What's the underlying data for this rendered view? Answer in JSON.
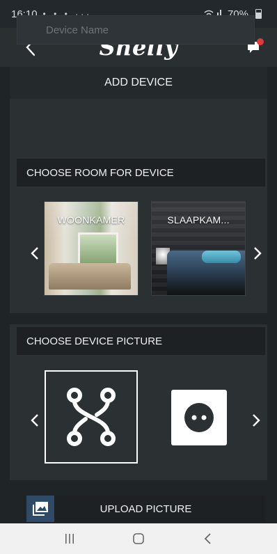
{
  "status_bar": {
    "time": "16:10",
    "notification_icons": "• • • ···",
    "battery": "70%"
  },
  "app_bar": {
    "logo_text": "Shelly",
    "back_icon": "chevron-left-icon",
    "chat_icon": "chat-notification-icon",
    "accent_color": "#5dbb46",
    "notification_dot_color": "#e53935"
  },
  "page": {
    "title": "ADD DEVICE"
  },
  "device_name": {
    "value": "",
    "placeholder": "Device Name"
  },
  "room_section": {
    "header": "CHOOSE ROOM FOR DEVICE",
    "rooms": [
      {
        "label": "WOONKAMER"
      },
      {
        "label": "SLAAPKAM..."
      }
    ]
  },
  "picture_section": {
    "header": "CHOOSE DEVICE PICTURE",
    "pictures": [
      {
        "icon": "switch-node-icon",
        "selected": true
      },
      {
        "icon": "power-socket-icon",
        "selected": false
      }
    ]
  },
  "upload": {
    "label": "UPLOAD PICTURE",
    "icon": "image-icon",
    "icon_bg_color": "#2e4a66"
  },
  "nav_bar": {
    "recents_icon": "recents-icon",
    "home_icon": "home-icon",
    "back_icon": "back-icon"
  }
}
